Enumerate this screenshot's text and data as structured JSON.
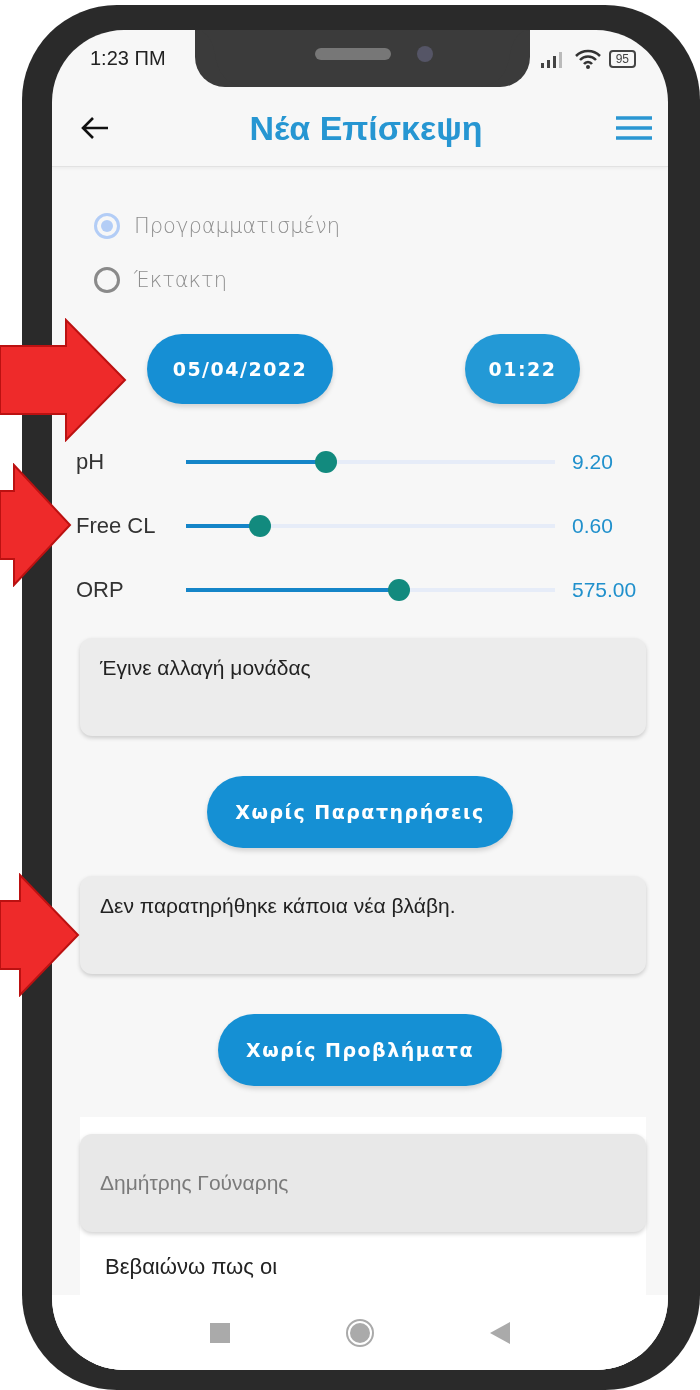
{
  "status_bar": {
    "time": "1:23 ΠΜ",
    "battery": "95"
  },
  "header": {
    "title": "Νέα Επίσκεψη"
  },
  "visit_type": [
    {
      "label": "Προγραμματισμένη",
      "selected": true
    },
    {
      "label": "Έκτακτη",
      "selected": false
    }
  ],
  "date_time": {
    "date": "05/04/2022",
    "time": "01:22"
  },
  "measurements": [
    {
      "name": "pH",
      "level": 0.38,
      "reading": "9.20"
    },
    {
      "name": "Free CL",
      "level": 0.2,
      "reading": "0.60"
    },
    {
      "name": "ORP",
      "level": 0.576,
      "reading": "575.00"
    }
  ],
  "notes": {
    "value": "Έγινε αλλαγή μονάδας",
    "button": "Χωρίς Παρατηρήσεις"
  },
  "problems": {
    "value": "Δεν παρατηρήθηκε κάποια νέα βλάβη.",
    "button": "Χωρίς Προβλήματα"
  },
  "signature": {
    "name_placeholder": "Δημήτρης Γούναρης",
    "statement": "Βεβαιώνω πως οι"
  }
}
